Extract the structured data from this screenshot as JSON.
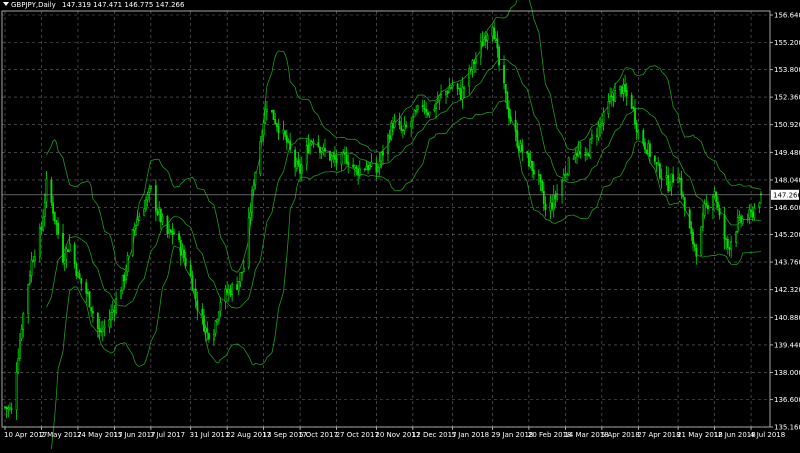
{
  "window": {
    "symbol_label": "GBPJPY,Daily",
    "ohlc_values": "147.319 147.471 146.775 147.266"
  },
  "chart_data": {
    "type": "candlestick",
    "symbol": "GBPJPY",
    "timeframe": "Daily",
    "title": "GBPJPY,Daily",
    "ohlc_last": {
      "open": 147.319,
      "high": 147.471,
      "low": 146.775,
      "close": 147.266
    },
    "current_price": "147.266",
    "ylim": [
      135.16,
      156.64
    ],
    "y_ticks": [
      "156.640",
      "155.200",
      "153.800",
      "152.360",
      "150.920",
      "149.480",
      "148.040",
      "146.600",
      "145.200",
      "143.760",
      "142.320",
      "140.880",
      "139.440",
      "138.000",
      "136.600",
      "135.160"
    ],
    "x_ticks": [
      "10 Apr 2017",
      "2 May 2017",
      "24 May 2017",
      "15 Jun 2017",
      "7 Jul 2017",
      "31 Jul 2017",
      "22 Aug 2017",
      "13 Sep 2017",
      "5 Oct 2017",
      "27 Oct 2017",
      "20 Nov 2017",
      "12 Dec 2017",
      "5 Jan 2018",
      "29 Jan 2018",
      "20 Feb 2018",
      "14 Mar 2018",
      "5 Apr 2018",
      "27 Apr 2018",
      "21 May 2018",
      "12 Jun 2018",
      "4 Jul 2018"
    ],
    "grid": true,
    "close_path": [
      [
        "10 Apr 2017",
        136.2
      ],
      [
        "14 Apr 2017",
        136.0
      ],
      [
        "20 Apr 2017",
        140.5
      ],
      [
        "26 Apr 2017",
        143.8
      ],
      [
        "2 May 2017",
        145.5
      ],
      [
        "5 May 2017",
        147.8
      ],
      [
        "9 May 2017",
        146.5
      ],
      [
        "15 May 2017",
        144.0
      ],
      [
        "19 May 2017",
        144.7
      ],
      [
        "24 May 2017",
        143.0
      ],
      [
        "30 May 2017",
        142.0
      ],
      [
        "6 Jun 2017",
        140.0
      ],
      [
        "12 Jun 2017",
        140.8
      ],
      [
        "15 Jun 2017",
        141.5
      ],
      [
        "21 Jun 2017",
        143.0
      ],
      [
        "27 Jun 2017",
        145.6
      ],
      [
        "3 Jul 2017",
        146.8
      ],
      [
        "7 Jul 2017",
        147.5
      ],
      [
        "11 Jul 2017",
        146.4
      ],
      [
        "17 Jul 2017",
        145.2
      ],
      [
        "21 Jul 2017",
        145.3
      ],
      [
        "27 Jul 2017",
        144.0
      ],
      [
        "31 Jul 2017",
        143.0
      ],
      [
        "4 Aug 2017",
        141.5
      ],
      [
        "10 Aug 2017",
        140.0
      ],
      [
        "14 Aug 2017",
        140.3
      ],
      [
        "18 Aug 2017",
        141.8
      ],
      [
        "22 Aug 2017",
        142.2
      ],
      [
        "28 Aug 2017",
        142.6
      ],
      [
        "1 Sep 2017",
        143.5
      ],
      [
        "7 Sep 2017",
        148.0
      ],
      [
        "13 Sep 2017",
        151.2
      ],
      [
        "15 Sep 2017",
        152.0
      ],
      [
        "21 Sep 2017",
        151.0
      ],
      [
        "27 Sep 2017",
        150.0
      ],
      [
        "2 Oct 2017",
        148.8
      ],
      [
        "5 Oct 2017",
        148.5
      ],
      [
        "9 Oct 2017",
        149.6
      ],
      [
        "13 Oct 2017",
        150.3
      ],
      [
        "19 Oct 2017",
        149.5
      ],
      [
        "27 Oct 2017",
        149.0
      ],
      [
        "2 Nov 2017",
        149.2
      ],
      [
        "8 Nov 2017",
        148.5
      ],
      [
        "14 Nov 2017",
        148.8
      ],
      [
        "20 Nov 2017",
        148.5
      ],
      [
        "24 Nov 2017",
        149.5
      ],
      [
        "30 Nov 2017",
        151.0
      ],
      [
        "6 Dec 2017",
        150.5
      ],
      [
        "12 Dec 2017",
        151.2
      ],
      [
        "18 Dec 2017",
        152.0
      ],
      [
        "22 Dec 2017",
        151.5
      ],
      [
        "28 Dec 2017",
        152.3
      ],
      [
        "5 Jan 2018",
        153.0
      ],
      [
        "10 Jan 2018",
        152.5
      ],
      [
        "16 Jan 2018",
        153.8
      ],
      [
        "22 Jan 2018",
        155.0
      ],
      [
        "26 Jan 2018",
        155.8
      ],
      [
        "29 Jan 2018",
        156.3
      ],
      [
        "2 Feb 2018",
        154.0
      ],
      [
        "8 Feb 2018",
        151.5
      ],
      [
        "14 Feb 2018",
        149.8
      ],
      [
        "20 Feb 2018",
        149.0
      ],
      [
        "26 Feb 2018",
        148.0
      ],
      [
        "2 Mar 2018",
        146.4
      ],
      [
        "6 Mar 2018",
        146.8
      ],
      [
        "10 Mar 2018",
        147.5
      ],
      [
        "14 Mar 2018",
        148.5
      ],
      [
        "20 Mar 2018",
        149.6
      ],
      [
        "26 Mar 2018",
        149.0
      ],
      [
        "30 Mar 2018",
        150.2
      ],
      [
        "5 Apr 2018",
        151.0
      ],
      [
        "11 Apr 2018",
        152.4
      ],
      [
        "17 Apr 2018",
        152.8
      ],
      [
        "23 Apr 2018",
        152.0
      ],
      [
        "27 Apr 2018",
        150.5
      ],
      [
        "3 May 2018",
        149.6
      ],
      [
        "9 May 2018",
        148.6
      ],
      [
        "15 May 2018",
        147.8
      ],
      [
        "21 May 2018",
        148.5
      ],
      [
        "25 May 2018",
        146.5
      ],
      [
        "29 May 2018",
        145.0
      ],
      [
        "2 Jun 2018",
        144.2
      ],
      [
        "6 Jun 2018",
        146.5
      ],
      [
        "12 Jun 2018",
        147.5
      ],
      [
        "16 Jun 2018",
        145.5
      ],
      [
        "20 Jun 2018",
        144.5
      ],
      [
        "26 Jun 2018",
        145.8
      ],
      [
        "30 Jun 2018",
        146.0
      ],
      [
        "4 Jul 2018",
        146.2
      ],
      [
        "10 Jul 2018",
        147.266
      ]
    ]
  }
}
